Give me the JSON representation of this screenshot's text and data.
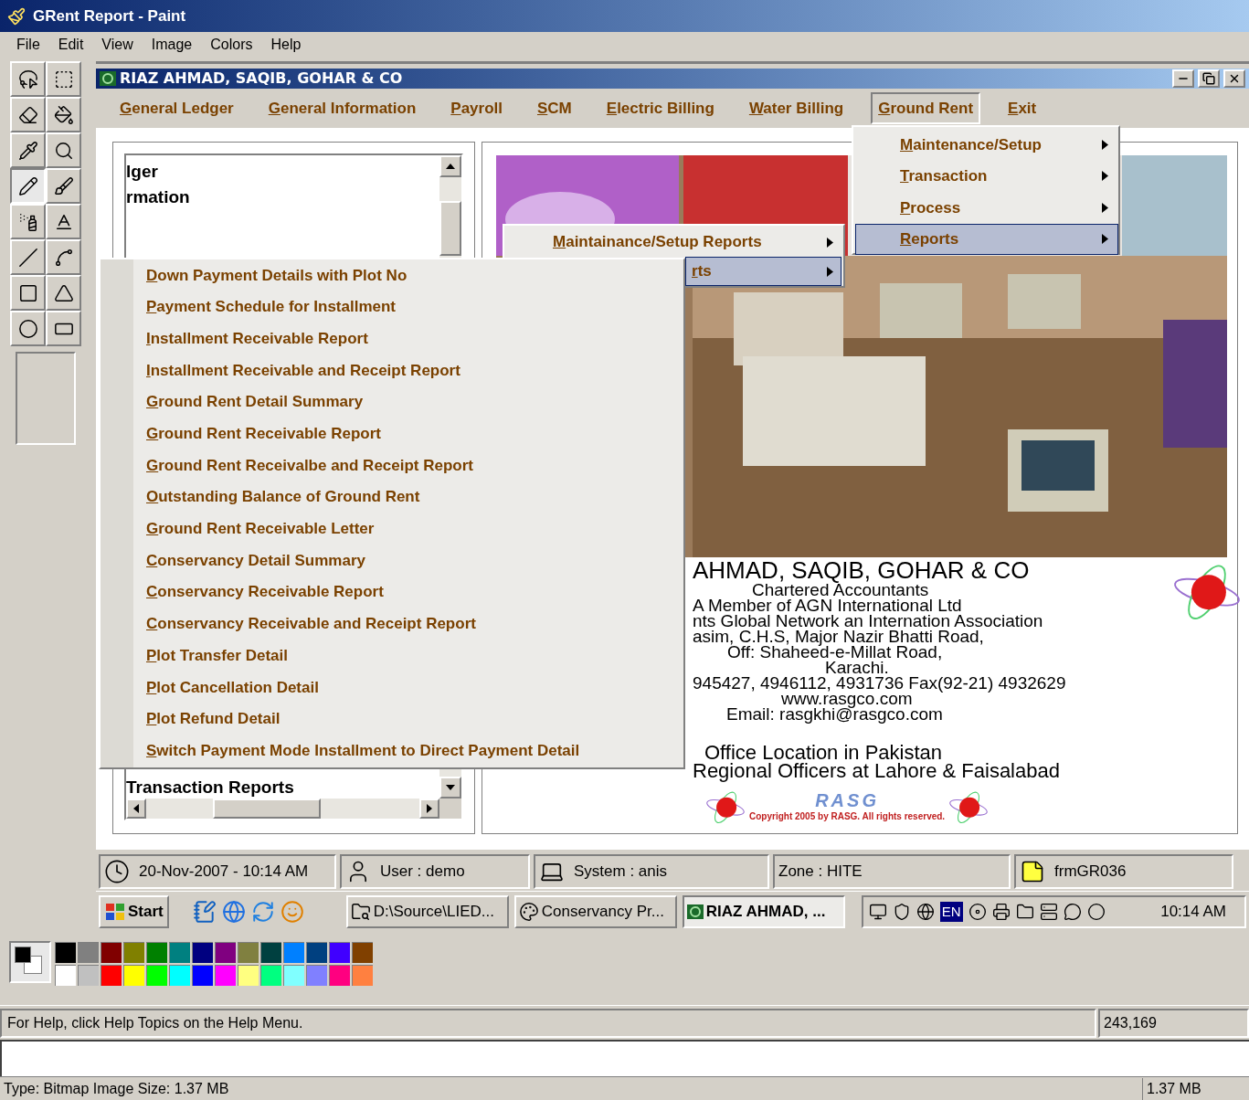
{
  "paint": {
    "title": "GRent Report - Paint",
    "menu": [
      "File",
      "Edit",
      "View",
      "Image",
      "Colors",
      "Help"
    ],
    "tools": [
      {
        "selected": false
      },
      {
        "selected": false
      },
      {
        "selected": false
      },
      {
        "selected": false
      },
      {
        "selected": false
      },
      {
        "selected": false
      },
      {
        "selected": true
      },
      {
        "selected": false
      },
      {
        "selected": false
      },
      {
        "selected": false
      },
      {
        "selected": false
      },
      {
        "selected": false
      },
      {
        "selected": false
      },
      {
        "selected": false
      },
      {
        "selected": false
      },
      {
        "selected": false
      }
    ],
    "palette": [
      {
        "color": "#000000"
      },
      {
        "color": "#808080"
      },
      {
        "color": "#800000"
      },
      {
        "color": "#808000"
      },
      {
        "color": "#008000"
      },
      {
        "color": "#008080"
      },
      {
        "color": "#000080"
      },
      {
        "color": "#800080"
      },
      {
        "color": "#808040"
      },
      {
        "color": "#004040"
      },
      {
        "color": "#0080ff"
      },
      {
        "color": "#004080"
      },
      {
        "color": "#4000ff"
      },
      {
        "color": "#804000"
      },
      {
        "color": "#ffffff"
      },
      {
        "color": "#c0c0c0"
      },
      {
        "color": "#ff0000"
      },
      {
        "color": "#ffff00"
      },
      {
        "color": "#00ff00"
      },
      {
        "color": "#00ffff"
      },
      {
        "color": "#0000ff"
      },
      {
        "color": "#ff00ff"
      },
      {
        "color": "#ffff80"
      },
      {
        "color": "#00ff80"
      },
      {
        "color": "#80ffff"
      },
      {
        "color": "#8080ff"
      },
      {
        "color": "#ff0080"
      },
      {
        "color": "#ff8040"
      }
    ],
    "status_help": "For Help, click Help Topics on the Help Menu.",
    "status_coords": "243,169",
    "info": "Type: Bitmap Image Size: 1.37 MB",
    "info_size": "1.37 MB"
  },
  "app": {
    "title": "RIAZ AHMAD, SAQIB, GOHAR & CO",
    "menu": [
      {
        "label": "General Ledger",
        "selected": false
      },
      {
        "label": "General Information",
        "selected": false
      },
      {
        "label": "Payroll",
        "selected": false
      },
      {
        "label": "SCM",
        "selected": false
      },
      {
        "label": "Electric Billing",
        "selected": false
      },
      {
        "label": "Water Billing",
        "selected": false
      },
      {
        "label": "Ground Rent",
        "selected": true
      },
      {
        "label": "Exit",
        "selected": false
      }
    ],
    "list_top": [
      "lger",
      "rmation"
    ],
    "list_bottom": "Transaction Reports",
    "letterhead": [
      {
        "text": "AHMAD, SAQIB, GOHAR & CO",
        "kind": "heading"
      },
      {
        "text": "Chartered Accountants",
        "kind": "line"
      },
      {
        "text": "A Member of AGN International Ltd",
        "kind": "line"
      },
      {
        "text": "nts Global Network an Internation Association",
        "kind": "line"
      },
      {
        "text": "asim, C.H.S, Major Nazir Bhatti Road,",
        "kind": "line"
      },
      {
        "text": "Off: Shaheed-e-Millat Road,",
        "kind": "line"
      },
      {
        "text": "Karachi.",
        "kind": "line"
      },
      {
        "text": "945427, 4946112, 4931736 Fax(92-21) 4932629",
        "kind": "line"
      },
      {
        "text": "www.rasgco.com",
        "kind": "line"
      },
      {
        "text": "Email: rasgkhi@rasgco.com",
        "kind": "line"
      }
    ],
    "offices": [
      "Office Location in Pakistan",
      "Regional Officers at Lahore & Faisalabad"
    ],
    "logo_text": "RASG",
    "copyright": "Copyright 2005 by RASG. All rights reserved.",
    "status": [
      "20-Nov-2007 - 10:14 AM",
      "User : demo",
      "System : anis",
      "Zone : HITE",
      "frmGR036"
    ],
    "taskbar": {
      "start": "Start",
      "tasks": [
        {
          "label": "D:\\Source\\LIED...",
          "selected": false
        },
        {
          "label": "Conservancy Pr...",
          "selected": false
        },
        {
          "label": "RIAZ AHMAD, ...",
          "selected": true
        }
      ],
      "lang": "EN",
      "clock": "10:14 AM"
    }
  },
  "menus": {
    "ground_rent": [
      {
        "label": "Maintenance/Setup",
        "selected": false,
        "submenu": true
      },
      {
        "label": "Transaction",
        "selected": false,
        "submenu": true
      },
      {
        "label": "Process",
        "selected": false,
        "submenu": true
      },
      {
        "label": "Reports",
        "selected": true,
        "submenu": true
      }
    ],
    "reports": [
      {
        "label": "Maintainance/Setup Reports",
        "selected": false,
        "submenu": true
      },
      {
        "label": "rts",
        "selected": true,
        "submenu": true
      }
    ],
    "transaction_reports": [
      "Down Payment Details with Plot No",
      "Payment Schedule for Installment",
      "Installment Receivable Report",
      "Installment Receivable and Receipt Report",
      "Ground Rent Detail Summary",
      "Ground Rent Receivable Report",
      "Ground Rent Receivalbe and Receipt Report",
      "Outstanding Balance of Ground Rent",
      "Ground Rent Receivable Letter",
      "Conservancy Detail Summary",
      "Conservancy Receivable Report",
      "Conservancy Receivable and Receipt Report",
      "Plot Transfer Detail",
      "Plot Cancellation Detail",
      "Plot Refund Detail",
      "Switch Payment Mode Installment to Direct Payment Detail"
    ]
  }
}
